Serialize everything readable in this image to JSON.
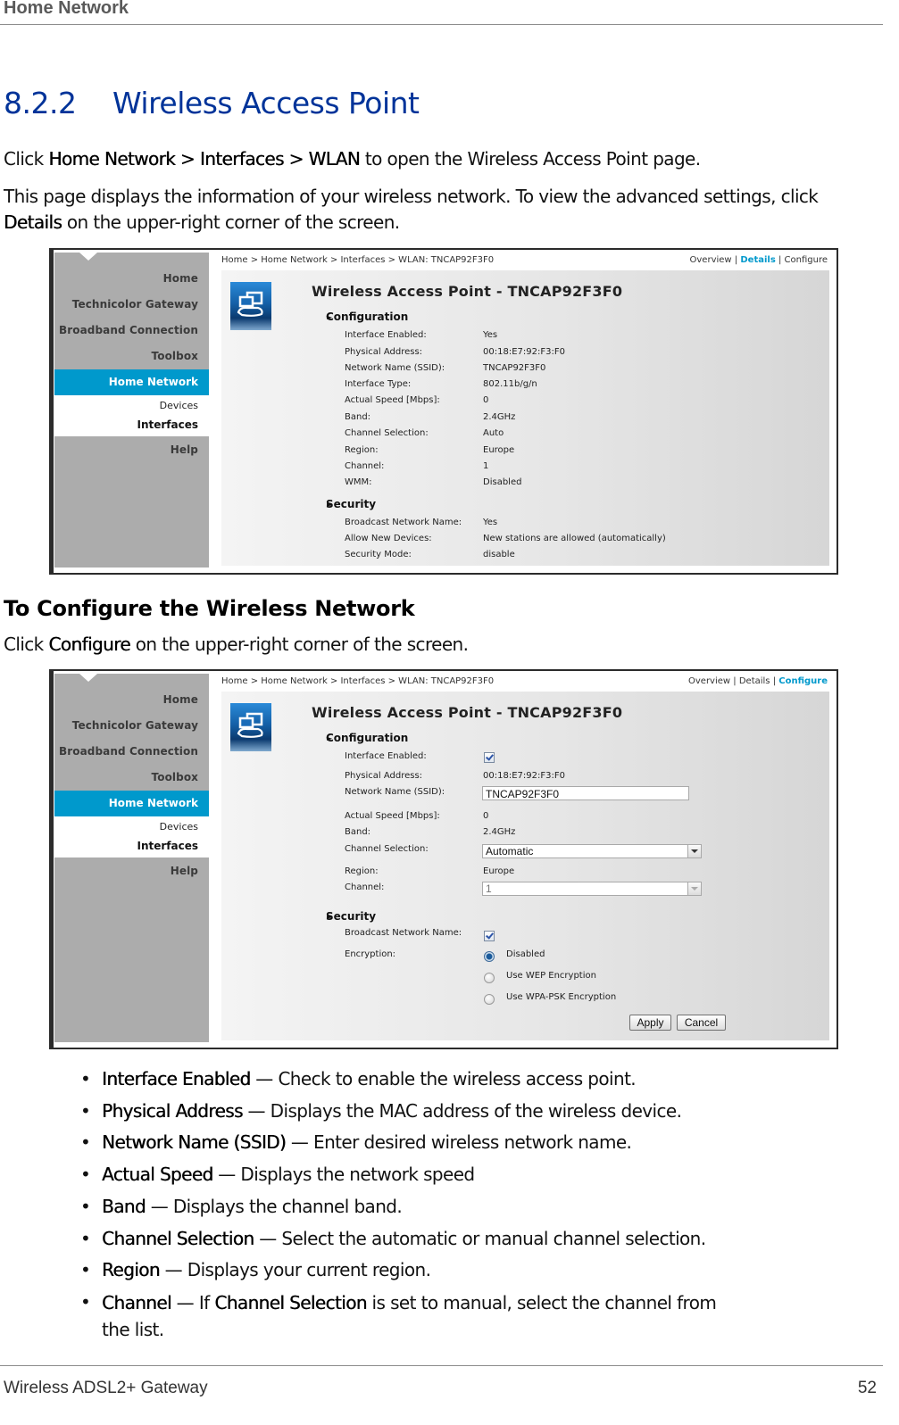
{
  "running_header": "Home Network",
  "section": {
    "number": "8.2.2",
    "title": "Wireless Access Point"
  },
  "intro": {
    "p1": {
      "pre": "Click ",
      "bold": "Home Network > Interfaces > WLAN",
      "post": " to open the Wireless Access Point page."
    },
    "p2": {
      "pre": "This page displays the information of your wireless network. To view the advanced settings, click ",
      "bold": "Details",
      "post": " on the upper-right corner of the screen."
    }
  },
  "screenshot_details": {
    "nav": {
      "items": [
        "Home",
        "Technicolor Gateway",
        "Broadband Connection",
        "Toolbox"
      ],
      "active": "Home Network",
      "sub_items": [
        "Devices",
        "Interfaces"
      ],
      "after": [
        "Help"
      ]
    },
    "breadcrumb": "Home > Home Network > Interfaces > WLAN: TNCAP92F3F0",
    "view_tabs": {
      "overview": "Overview",
      "details": "Details",
      "configure": "Configure",
      "separator": "|",
      "active": "Details"
    },
    "page_title": "Wireless Access Point - TNCAP92F3F0",
    "configuration": {
      "heading": "Configuration",
      "rows": [
        {
          "label": "Interface Enabled:",
          "value": "Yes"
        },
        {
          "label": "Physical Address:",
          "value": "00:18:E7:92:F3:F0"
        },
        {
          "label": "Network Name (SSID):",
          "value": "TNCAP92F3F0"
        },
        {
          "label": "Interface Type:",
          "value": "802.11b/g/n"
        },
        {
          "label": "Actual Speed [Mbps]:",
          "value": "0"
        },
        {
          "label": "Band:",
          "value": "2.4GHz"
        },
        {
          "label": "Channel Selection:",
          "value": "Auto"
        },
        {
          "label": "Region:",
          "value": "Europe"
        },
        {
          "label": "Channel:",
          "value": "1"
        },
        {
          "label": "WMM:",
          "value": "Disabled"
        }
      ]
    },
    "security": {
      "heading": "Security",
      "rows": [
        {
          "label": "Broadcast Network Name:",
          "value": "Yes"
        },
        {
          "label": "Allow New Devices:",
          "value": "New stations are allowed (automatically)"
        },
        {
          "label": "Security Mode:",
          "value": "disable"
        }
      ]
    }
  },
  "subheading": "To Configure the Wireless Network",
  "configure_para": {
    "pre": "Click ",
    "bold": "Configure",
    "post": " on the upper-right corner of the screen."
  },
  "screenshot_configure": {
    "nav": {
      "items": [
        "Home",
        "Technicolor Gateway",
        "Broadband Connection",
        "Toolbox"
      ],
      "active": "Home Network",
      "sub_items": [
        "Devices",
        "Interfaces"
      ],
      "after": [
        "Help"
      ]
    },
    "breadcrumb": "Home > Home Network > Interfaces > WLAN: TNCAP92F3F0",
    "view_tabs": {
      "overview": "Overview",
      "details": "Details",
      "configure": "Configure",
      "separator": "|",
      "active": "Configure"
    },
    "page_title": "Wireless Access Point - TNCAP92F3F0",
    "configuration": {
      "heading": "Configuration",
      "interface_enabled": {
        "label": "Interface Enabled:",
        "checked": true
      },
      "physical_address": {
        "label": "Physical Address:",
        "value": "00:18:E7:92:F3:F0"
      },
      "ssid": {
        "label": "Network Name (SSID):",
        "value": "TNCAP92F3F0"
      },
      "actual_speed": {
        "label": "Actual Speed [Mbps]:",
        "value": "0"
      },
      "band": {
        "label": "Band:",
        "value": "2.4GHz"
      },
      "channel_selection": {
        "label": "Channel Selection:",
        "selected": "Automatic"
      },
      "region": {
        "label": "Region:",
        "value": "Europe"
      },
      "channel": {
        "label": "Channel:",
        "selected": "1",
        "disabled": true
      }
    },
    "security": {
      "heading": "Security",
      "broadcast": {
        "label": "Broadcast Network Name:",
        "checked": true
      },
      "encryption": {
        "label": "Encryption:",
        "options": [
          "Disabled",
          "Use WEP Encryption",
          "Use WPA-PSK Encryption"
        ],
        "selected": "Disabled"
      }
    },
    "buttons": {
      "apply": "Apply",
      "cancel": "Cancel"
    }
  },
  "bullets": [
    {
      "term": "Interface Enabled",
      "desc": " — Check to enable the wireless access point."
    },
    {
      "term": "Physical Address",
      "desc": " — Displays the MAC address of the wireless device."
    },
    {
      "term": "Network Name (SSID)",
      "desc": " — Enter desired wireless network name."
    },
    {
      "term": "Actual Speed",
      "desc": " — Displays the network speed"
    },
    {
      "term": "Band",
      "desc": " — Displays the channel band."
    },
    {
      "term": "Channel Selection",
      "desc": " — Select the automatic or manual channel selection."
    },
    {
      "term": "Region",
      "desc": " — Displays your current region."
    },
    {
      "term": "Channel",
      "desc": " — If ",
      "term2": "Channel Selection",
      "desc2": " is set to manual, select the channel from",
      "cont": "the list."
    }
  ],
  "footer": {
    "left": "Wireless ADSL2+ Gateway",
    "page": "52"
  },
  "colors": {
    "heading_blue": "#003399",
    "nav_active": "#0099cc",
    "nav_bg": "#acacac"
  }
}
